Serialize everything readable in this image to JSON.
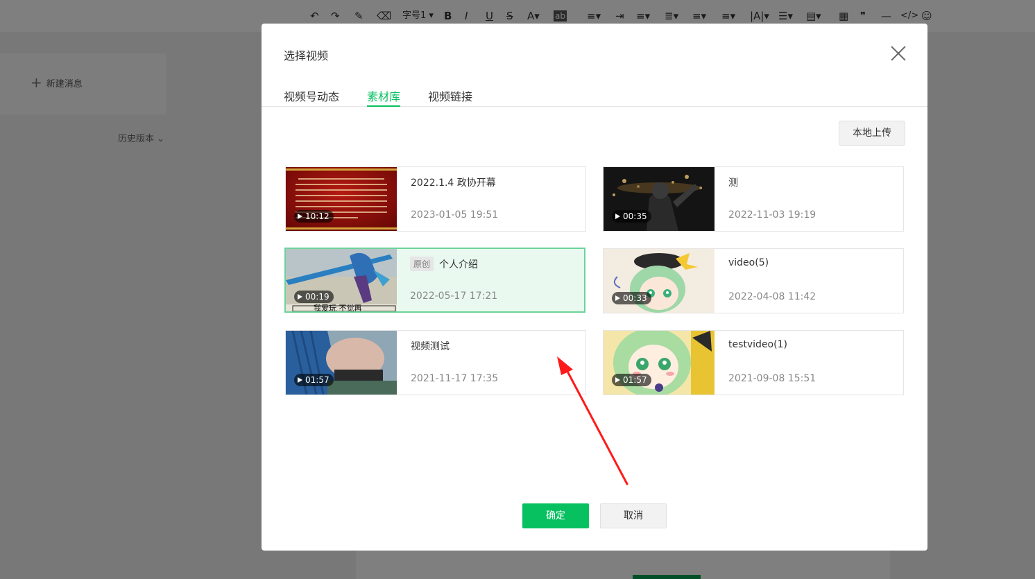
{
  "toolbar": {
    "font_size_label": "字号",
    "font_size_value": "1"
  },
  "sidebar": {
    "new_message": "新建消息",
    "history": "历史版本"
  },
  "dialog": {
    "title": "选择视频",
    "tabs": [
      {
        "label": "视频号动态",
        "active": false
      },
      {
        "label": "素材库",
        "active": true
      },
      {
        "label": "视频链接",
        "active": false
      }
    ],
    "upload_label": "本地上传",
    "videos": [
      {
        "title": "2022.1.4 政协开幕",
        "date": "2023-01-05 19:51",
        "duration": "10:12",
        "tag": "",
        "selected": false
      },
      {
        "title": "测",
        "date": "2022-11-03 19:19",
        "duration": "00:35",
        "tag": "",
        "selected": false
      },
      {
        "title": "个人介绍",
        "date": "2022-05-17 17:21",
        "duration": "00:19",
        "tag": "原创",
        "selected": true
      },
      {
        "title": "video(5)",
        "date": "2022-04-08 11:42",
        "duration": "00:33",
        "tag": "",
        "selected": false
      },
      {
        "title": "视频测试",
        "date": "2021-11-17 17:35",
        "duration": "01:57",
        "tag": "",
        "selected": false
      },
      {
        "title": "testvideo(1)",
        "date": "2021-09-08 15:51",
        "duration": "01:57",
        "tag": "",
        "selected": false
      }
    ],
    "confirm_label": "确定",
    "cancel_label": "取消"
  },
  "thumbnail_caption": "我爱玩 不觉再",
  "colors": {
    "accent": "#07c160",
    "selected_bg": "#e9f9f0",
    "annotation_arrow": "#ff1a1a"
  }
}
